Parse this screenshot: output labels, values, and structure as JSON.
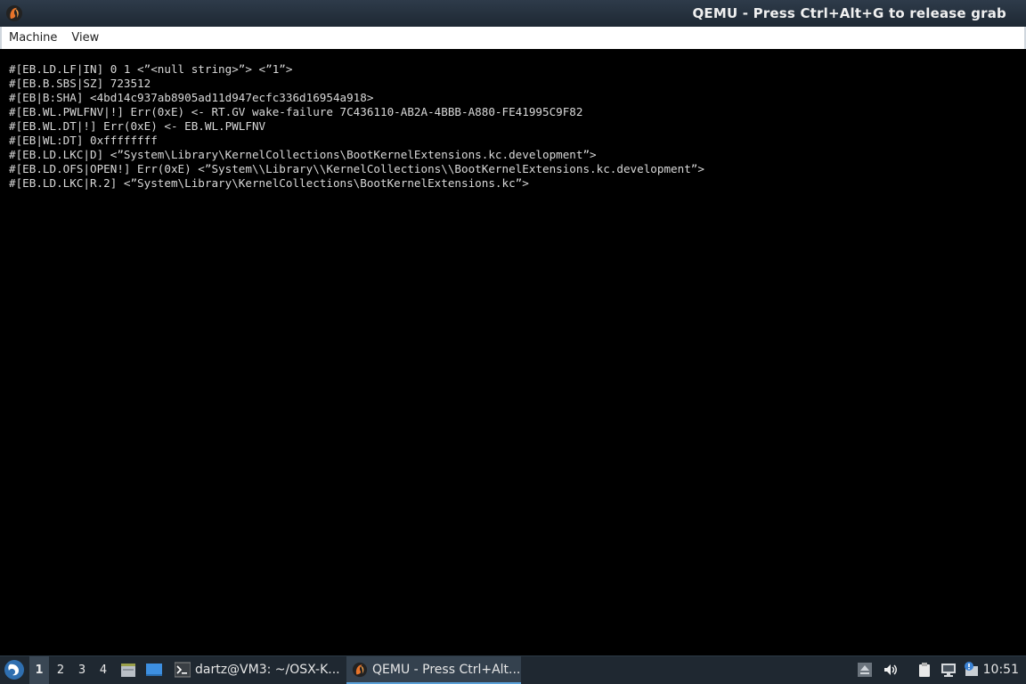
{
  "window": {
    "title": "QEMU - Press Ctrl+Alt+G to release grab",
    "app_icon": "qemu-icon"
  },
  "menu": {
    "items": [
      "Machine",
      "View"
    ]
  },
  "console": {
    "lines": [
      "#[EB.LD.LF|IN] 0 1 <”<null string>”> <”1”>",
      "#[EB.B.SBS|SZ] 723512",
      "#[EB|B:SHA] <4bd14c937ab8905ad11d947ecfc336d16954a918>",
      "#[EB.WL.PWLFNV|!] Err(0xE) <- RT.GV wake-failure 7C436110-AB2A-4BBB-A880-FE41995C9F82",
      "#[EB.WL.DT|!] Err(0xE) <- EB.WL.PWLFNV",
      "#[EB|WL:DT] 0xffffffff",
      "#[EB.LD.LKC|D] <”System\\Library\\KernelCollections\\BootKernelExtensions.kc.development”>",
      "#[EB.LD.OFS|OPEN!] Err(0xE) <”System\\\\Library\\\\KernelCollections\\\\BootKernelExtensions.kc.development”>",
      "#[EB.LD.LKC|R.2] <”System\\Library\\KernelCollections\\BootKernelExtensions.kc”>"
    ]
  },
  "taskbar": {
    "start_icon": "distro-start-icon",
    "workspaces": [
      "1",
      "2",
      "3",
      "4"
    ],
    "active_workspace": "1",
    "quick_launch": [
      "file-manager-icon",
      "show-desktop-icon"
    ],
    "tasks": [
      {
        "label": "dartz@VM3: ~/OSX-K...",
        "icon": "terminal-icon",
        "active": false
      },
      {
        "label": "QEMU - Press Ctrl+Alt...",
        "icon": "qemu-icon",
        "active": true
      }
    ],
    "tray_icons": [
      "eject-icon",
      "volume-icon",
      "clipboard-icon",
      "network-icon",
      "notification-icon"
    ],
    "clock": "10:51"
  },
  "colors": {
    "titlebar": "#2e3b4a",
    "console_bg": "#000000",
    "console_text": "#d9d9d9",
    "taskbar_bg": "#1f2831",
    "accent": "#5aa0d8"
  }
}
